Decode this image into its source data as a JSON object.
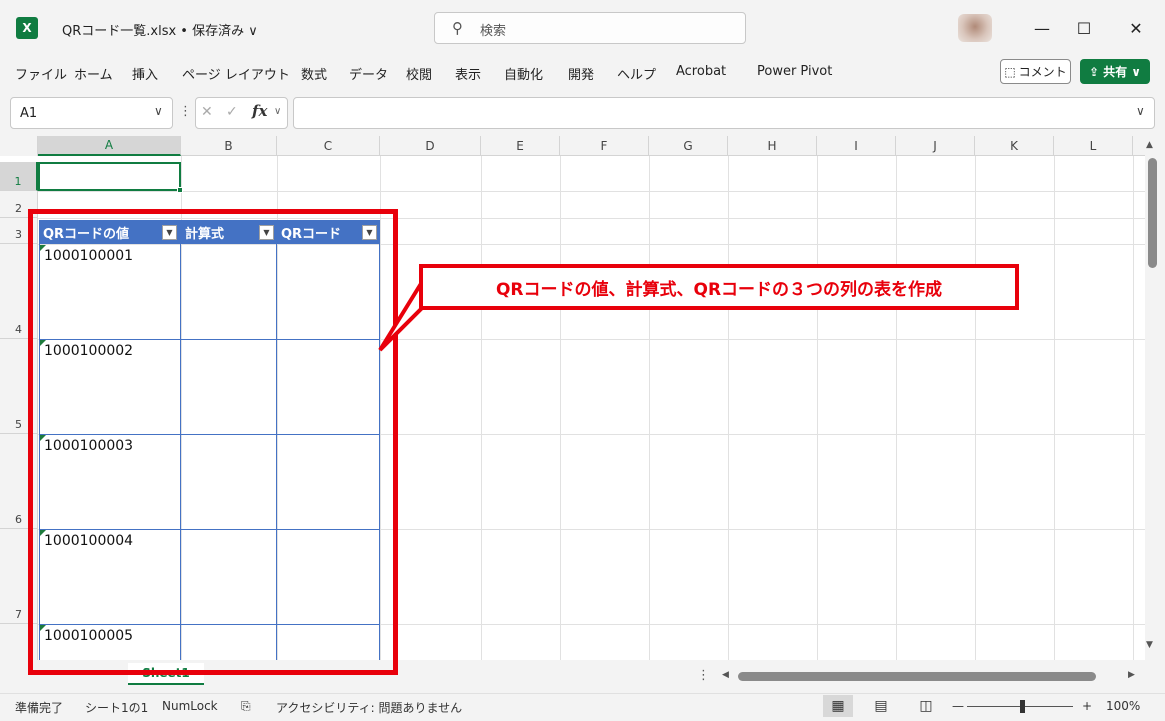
{
  "titlebar": {
    "app_icon": "X",
    "doc_title": "QRコード一覧.xlsx • 保存済み ∨",
    "search_placeholder": "検索",
    "search_icon": "⚲",
    "minimize": "—",
    "maximize": "☐",
    "close": "✕"
  },
  "ribbon": {
    "tabs": [
      "ファイル",
      "ホーム",
      "挿入",
      "ページ レイアウト",
      "数式",
      "データ",
      "校閲",
      "表示",
      "自動化",
      "開発",
      "ヘルプ",
      "Acrobat",
      "Power Pivot"
    ],
    "comment_icon": "⬚",
    "comment_label": "コメント",
    "share_icon": "⇪",
    "share_label": "共有 ∨"
  },
  "formula_bar": {
    "name_box": "A1",
    "name_chevron": "∨",
    "dots": "⋮",
    "cancel": "✕",
    "enter": "✓",
    "fx": "fx",
    "fx_chevron": "∨",
    "formula": "",
    "expand": "∨"
  },
  "grid": {
    "columns": [
      "A",
      "B",
      "C",
      "D",
      "E",
      "F",
      "G",
      "H",
      "I",
      "J",
      "K",
      "L"
    ],
    "rows": [
      "1",
      "2",
      "3",
      "4",
      "5",
      "6",
      "7"
    ],
    "selected_column": "A",
    "selected_row": "1"
  },
  "table": {
    "headers": [
      "QRコードの値",
      "計算式",
      "QRコード"
    ],
    "dropdown_glyph": "▼",
    "values": [
      "1000100001",
      "1000100002",
      "1000100003",
      "1000100004",
      "1000100005"
    ]
  },
  "callout": {
    "text": "QRコードの値、計算式、QRコードの３つの列の表を作成",
    "color": "#e8000b"
  },
  "sheet_tabs": {
    "active": "Sheet1",
    "dots": "⋮"
  },
  "scroll": {
    "up": "▲",
    "down": "▼",
    "left": "◀",
    "right": "▶"
  },
  "statusbar": {
    "ready": "準備完了",
    "sheet_count": "シート1の1",
    "numlock": "NumLock",
    "macro_icon": "⎘",
    "accessibility": "アクセシビリティ: 問題ありません",
    "view_normal": "▦",
    "view_layout": "▤",
    "view_pagebreak": "◫",
    "zoom_minus": "—",
    "zoom_plus": "+",
    "zoom": "100%"
  },
  "colors": {
    "excel_green": "#107c41",
    "table_header_blue": "#4472c4"
  }
}
